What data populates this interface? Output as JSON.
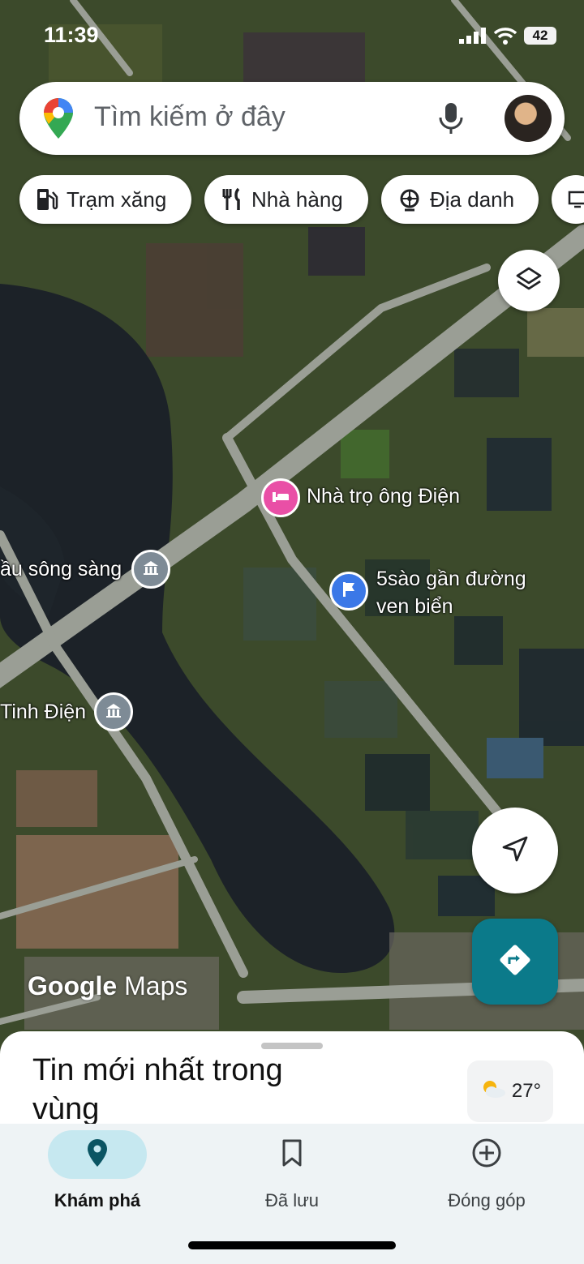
{
  "status_bar": {
    "time": "11:39",
    "battery": "42"
  },
  "search": {
    "placeholder": "Tìm kiếm ở đây"
  },
  "chips": [
    {
      "label": "Trạm xăng",
      "icon": "gas-station-icon"
    },
    {
      "label": "Nhà hàng",
      "icon": "restaurant-icon"
    },
    {
      "label": "Địa danh",
      "icon": "landmark-icon"
    }
  ],
  "map": {
    "places": [
      {
        "name": "Nhà trọ ông Điện",
        "icon": "hotel-icon",
        "color": "#e94fa6"
      },
      {
        "name": "5sào gần đường\nven biển",
        "icon": "flag-icon",
        "color": "#3b78e7"
      },
      {
        "name": "ầu sông sàng",
        "icon": "monument-icon",
        "color": "#7e8b96"
      },
      {
        "name": "Tinh Điện",
        "icon": "monument-icon",
        "color": "#7e8b96"
      }
    ],
    "watermark_google": "Google",
    "watermark_maps": "Maps",
    "layers_icon": "layers-icon",
    "location_icon": "navigation-arrow-icon",
    "directions_icon": "directions-icon",
    "accent": "#0b7a8a"
  },
  "sheet": {
    "title": "Tin mới nhất trong vùng",
    "weather": {
      "temp": "27°",
      "icon": "partly-cloudy-icon"
    }
  },
  "nav": [
    {
      "label": "Khám phá",
      "icon": "explore-pin-icon",
      "active": true
    },
    {
      "label": "Đã lưu",
      "icon": "bookmark-icon",
      "active": false
    },
    {
      "label": "Đóng góp",
      "icon": "add-circle-icon",
      "active": false
    }
  ]
}
